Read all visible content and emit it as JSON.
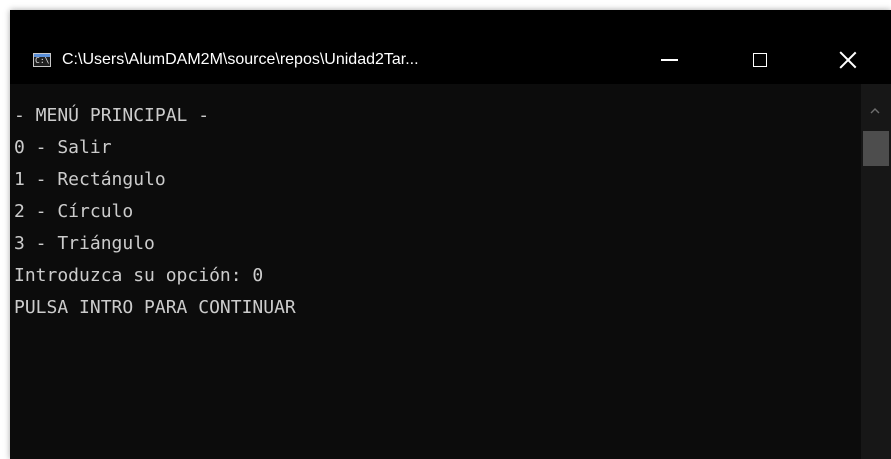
{
  "window": {
    "title": "C:\\Users\\AlumDAM2M\\source\\repos\\Unidad2Tar...",
    "icon": "console-app-icon",
    "icon_glyph": "C:\\",
    "controls": {
      "minimize": "minimize-icon",
      "maximize": "maximize-icon",
      "close": "close-icon"
    }
  },
  "console": {
    "lines": [
      "- MENÚ PRINCIPAL -",
      "0 - Salir",
      "1 - Rectángulo",
      "2 - Círculo",
      "3 - Triángulo",
      "Introduzca su opción: 0",
      "PULSA INTRO PARA CONTINUAR"
    ],
    "background_color": "#0c0c0c",
    "text_color": "#cccccc"
  },
  "scrollbar": {
    "up_icon": "chevron-up-icon"
  }
}
